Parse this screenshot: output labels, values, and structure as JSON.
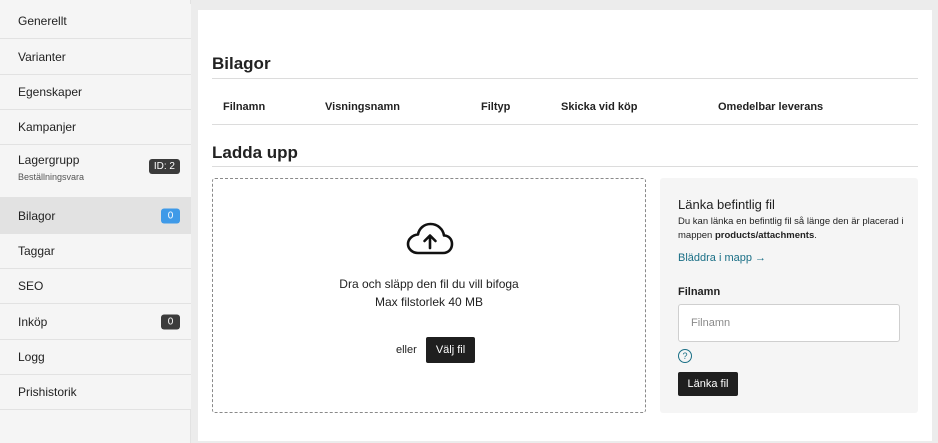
{
  "sidebar": {
    "items": [
      {
        "label": "Generellt"
      },
      {
        "label": "Varianter"
      },
      {
        "label": "Egenskaper"
      },
      {
        "label": "Kampanjer"
      },
      {
        "label": "Lagergrupp",
        "sublabel": "Beställningsvara",
        "badge": "ID: 2"
      },
      {
        "label": "Bilagor",
        "badge": "0",
        "active": true
      },
      {
        "label": "Taggar"
      },
      {
        "label": "SEO"
      },
      {
        "label": "Inköp",
        "badge": "0"
      },
      {
        "label": "Logg"
      },
      {
        "label": "Prishistorik"
      }
    ]
  },
  "attachments": {
    "title": "Bilagor",
    "columns": [
      "Filnamn",
      "Visningsnamn",
      "Filtyp",
      "Skicka vid köp",
      "Omedelbar leverans"
    ]
  },
  "upload": {
    "title": "Ladda upp",
    "drop_text": "Dra och släpp den fil du vill bifoga",
    "max_size": "Max filstorlek 40 MB",
    "or_text": "eller",
    "choose_button": "Välj fil"
  },
  "link_existing": {
    "title": "Länka befintlig fil",
    "desc_before": "Du kan länka en befintlig fil så länge den är placerad i mappen ",
    "desc_path": "products/attachments",
    "desc_after": ".",
    "browse_link": "Bläddra i mapp →",
    "field_label": "Filnamn",
    "field_placeholder": "Filnamn",
    "field_value": "",
    "help_glyph": "?",
    "link_button": "Länka fil"
  },
  "colors": {
    "badge_active": "#3f9ae8",
    "badge_default": "#3b3b3b",
    "link": "#1a6f86",
    "button_dark": "#1f1f1f"
  }
}
